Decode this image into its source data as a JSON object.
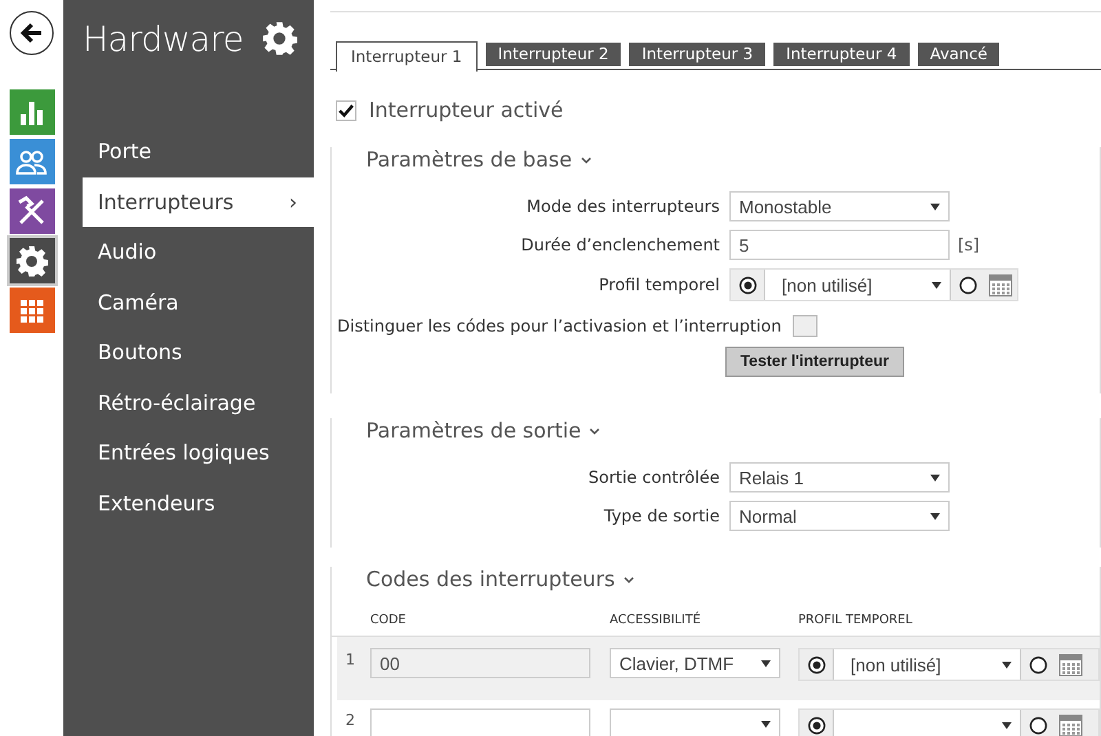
{
  "page_title": "Hardware",
  "app_nav": [
    {
      "kind": "stats",
      "color": "#3c9a3c",
      "selected": false
    },
    {
      "kind": "users",
      "color": "#3a8fd6",
      "selected": false
    },
    {
      "kind": "tools",
      "color": "#7f4aa0",
      "selected": false
    },
    {
      "kind": "settings",
      "color": "#4a4a4a",
      "selected": true
    },
    {
      "kind": "grid",
      "color": "#e55a1c",
      "selected": false
    }
  ],
  "sidebar": {
    "items": [
      {
        "label": "Porte",
        "selected": false
      },
      {
        "label": "Interrupteurs",
        "selected": true,
        "chevron": "›"
      },
      {
        "label": "Audio",
        "selected": false
      },
      {
        "label": "Caméra",
        "selected": false
      },
      {
        "label": "Boutons",
        "selected": false
      },
      {
        "label": "Rétro-éclairage",
        "selected": false
      },
      {
        "label": "Entrées logiques",
        "selected": false
      },
      {
        "label": "Extendeurs",
        "selected": false
      }
    ]
  },
  "tabs": [
    {
      "label": "Interrupteur 1",
      "selected": true
    },
    {
      "label": "Interrupteur 2",
      "selected": false
    },
    {
      "label": "Interrupteur 3",
      "selected": false
    },
    {
      "label": "Interrupteur 4",
      "selected": false
    },
    {
      "label": "Avancé",
      "selected": false
    }
  ],
  "enabled": {
    "label": "Interrupteur activé",
    "checked": true
  },
  "basic": {
    "title": "Paramètres de base",
    "mode": {
      "label": "Mode des interrupteurs",
      "value": "Monostable"
    },
    "duration": {
      "label": "Durée d’enclenchement",
      "value": "5",
      "unit": "[s]"
    },
    "profile": {
      "label": "Profil temporel",
      "value": "[non utilisé]",
      "first_selected": true
    },
    "distinguish": {
      "label": "Distinguer les códes pour l’activasion et l’interruption",
      "checked": false
    },
    "test_button": "Tester l'interrupteur"
  },
  "output": {
    "title": "Paramètres de sortie",
    "controlled": {
      "label": "Sortie contrôlée",
      "value": "Relais 1"
    },
    "type": {
      "label": "Type de sortie",
      "value": "Normal"
    }
  },
  "codes": {
    "title": "Codes des interrupteurs",
    "columns": [
      "CODE",
      "ACCESSIBILITÉ",
      "PROFIL TEMPOREL"
    ],
    "rows": [
      {
        "index": "1",
        "code": "00",
        "access": "Clavier, DTMF",
        "profile": "[non utilisé]",
        "first_selected": true
      },
      {
        "index": "2",
        "first_selected": true
      }
    ]
  }
}
